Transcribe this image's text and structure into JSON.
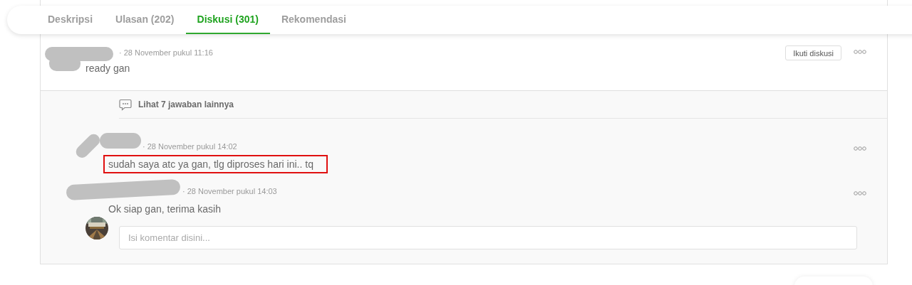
{
  "tabs": [
    {
      "label": "Deskripsi",
      "selected": false
    },
    {
      "label": "Ulasan (202)",
      "selected": false
    },
    {
      "label": "Diskusi (301)",
      "selected": true
    },
    {
      "label": "Rekomendasi",
      "selected": false
    }
  ],
  "question": {
    "date": "· 28 November pukul 11:16",
    "text": "ready gan",
    "follow_button": "Ikuti diskusi"
  },
  "more_replies": "Lihat 7 jawaban lainnya",
  "replies": [
    {
      "date": "· 28 November pukul 14:02",
      "text": "sudah saya atc ya gan, tlg diproses hari ini.. tq",
      "highlighted": true
    },
    {
      "date": "· 28 November pukul 14:03",
      "text": "Ok siap gan, terima kasih",
      "highlighted": false
    }
  ],
  "comment": {
    "placeholder": "Isi komentar disini..."
  }
}
